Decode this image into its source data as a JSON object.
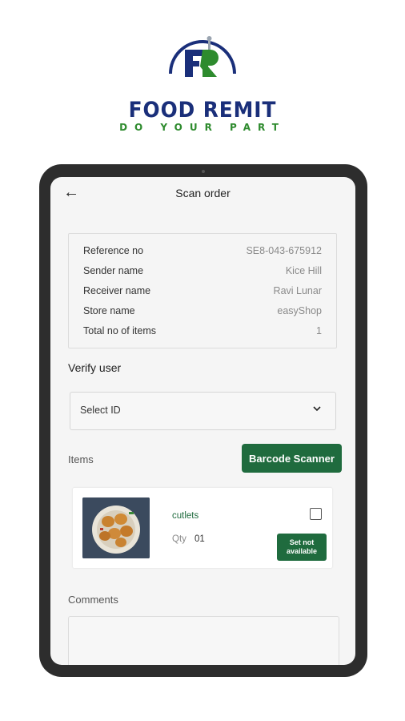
{
  "brand": {
    "logo_letters": "FR",
    "name": "FOOD REMIT",
    "tagline": "DO YOUR PART",
    "primary_color": "#1a2f7a",
    "accent_color": "#2e8b2e"
  },
  "header": {
    "back_icon": "arrow-left-icon",
    "title": "Scan order"
  },
  "order_info": {
    "rows": [
      {
        "label": "Reference no",
        "value": "SE8-043-675912"
      },
      {
        "label": "Sender name",
        "value": "Kice Hill"
      },
      {
        "label": "Receiver name",
        "value": "Ravi Lunar"
      },
      {
        "label": "Store name",
        "value": "easyShop"
      },
      {
        "label": "Total no of items",
        "value": "1"
      }
    ]
  },
  "verify": {
    "label": "Verify user",
    "select_value": "Select ID",
    "select_icon": "chevron-down-icon"
  },
  "items_section": {
    "label": "Items",
    "barcode_button": "Barcode Scanner",
    "items": [
      {
        "name": "cutlets",
        "qty_label": "Qty",
        "qty_value": "01",
        "action_button": "Set not available",
        "checked": false
      }
    ]
  },
  "comments": {
    "label": "Comments",
    "value": ""
  },
  "colors": {
    "button_green": "#1f6b3e",
    "frame": "#2d2d2d"
  }
}
